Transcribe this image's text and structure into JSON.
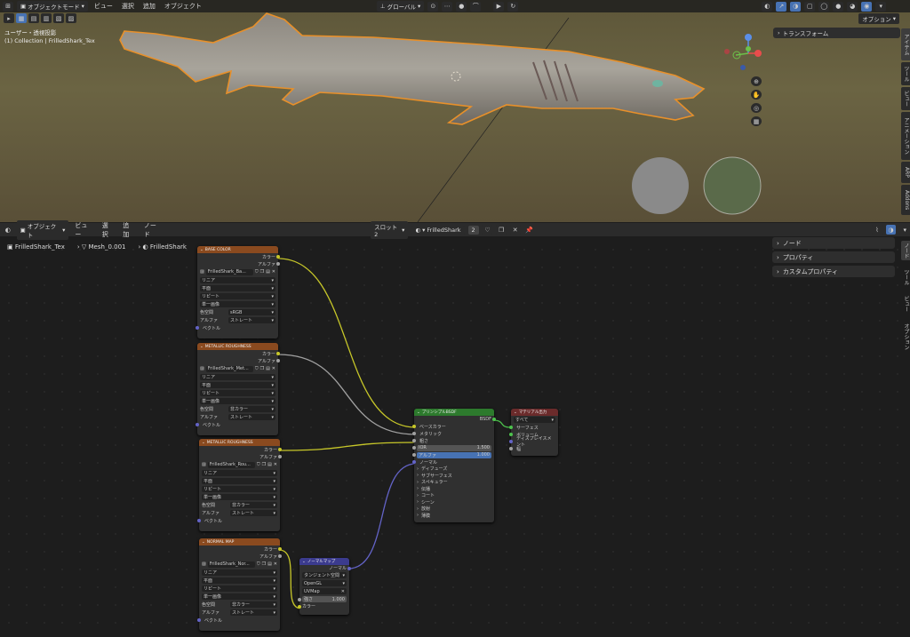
{
  "viewport": {
    "mode": "オブジェクトモード",
    "menus": [
      "ビュー",
      "選択",
      "追加",
      "オブジェクト"
    ],
    "transform_orientation": "グローバル",
    "options": "オプション",
    "view_name": "ユーザー・透視投影",
    "collection_info": "(1) Collection | FrilledShark_Tex",
    "transform_panel": "トランスフォーム",
    "tabs": [
      "アイテム",
      "ツール",
      "ビュー",
      "アニメーション",
      "ARP",
      "Addons"
    ]
  },
  "node_editor": {
    "mode": "オブジェクト",
    "menus": [
      "ビュー",
      "選択",
      "追加",
      "ノード"
    ],
    "slot": "スロット2",
    "material": "FrilledShark",
    "users": "2",
    "breadcrumb": [
      "FrilledShark_Tex",
      "Mesh_0.001",
      "FrilledShark"
    ],
    "panels": [
      "ノード",
      "プロパティ",
      "カスタムプロパティ"
    ],
    "tabs": [
      "ノード",
      "ツール",
      "ビュー",
      "オプション"
    ]
  },
  "nodes": {
    "base": {
      "title": "BASE COLOR",
      "out1": "カラー",
      "out2": "アルファ",
      "image": "FrilledShark_Ba...",
      "interp": "リニア",
      "proj": "平面",
      "ext": "リピート",
      "src": "単一画像",
      "cs_label": "色空間",
      "cs": "sRGB",
      "alpha_label": "アルファ",
      "alpha": "ストレート",
      "vec": "ベクトル"
    },
    "mr1": {
      "title": "METALLIC ROUGHNESS",
      "out1": "カラー",
      "out2": "アルファ",
      "image": "FrilledShark_Met...",
      "interp": "リニア",
      "proj": "平面",
      "ext": "リピート",
      "src": "単一画像",
      "cs_label": "色空間",
      "cs": "非カラー",
      "alpha_label": "アルファ",
      "alpha": "ストレート",
      "vec": "ベクトル"
    },
    "mr2": {
      "title": "METALLIC ROUGHNESS",
      "out1": "カラー",
      "out2": "アルファ",
      "image": "FrilledShark_Rou...",
      "interp": "リニア",
      "proj": "平面",
      "ext": "リピート",
      "src": "単一画像",
      "cs_label": "色空間",
      "cs": "非カラー",
      "alpha_label": "アルファ",
      "alpha": "ストレート",
      "vec": "ベクトル"
    },
    "nrm": {
      "title": "NORMAL MAP",
      "out1": "カラー",
      "out2": "アルファ",
      "image": "FrilledShark_Nor...",
      "interp": "リニア",
      "proj": "平面",
      "ext": "リピート",
      "src": "単一画像",
      "cs_label": "色空間",
      "cs": "非カラー",
      "alpha_label": "アルファ",
      "alpha": "ストレート",
      "vec": "ベクトル"
    },
    "nmap": {
      "title": "ノーマルマップ",
      "out": "ノーマル",
      "space": "タンジェント空間",
      "uv_mode": "OpenGL",
      "uv": "UVMap",
      "strength_label": "強さ",
      "strength": "1.000",
      "color": "カラー"
    },
    "bsdf": {
      "title": "プリンシプルBSDF",
      "out": "BSDF",
      "base": "ベースカラー",
      "metal": "メタリック",
      "rough": "粗さ",
      "ior_label": "IOR",
      "ior": "1.500",
      "alpha_label": "アルファ",
      "alpha": "1.000",
      "normal": "ノーマル",
      "subs": [
        "ディフューズ",
        "サブサーフェス",
        "スペキュラー",
        "伝播",
        "コート",
        "シーン",
        "放射",
        "薄膜"
      ]
    },
    "out": {
      "title": "マテリアル出力",
      "target": "すべて",
      "surface": "サーフェス",
      "volume": "ボリューム",
      "disp": "ディスプレイスメント",
      "thick": "幅"
    }
  }
}
